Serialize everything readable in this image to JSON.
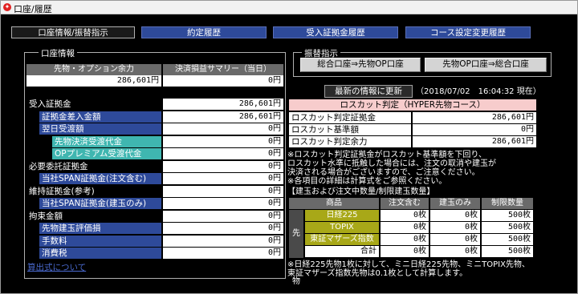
{
  "window": {
    "title": "口座/履歴",
    "app_icon": "app-logo-icon"
  },
  "tabs": [
    {
      "label": "口座情報/振替指示",
      "active": true
    },
    {
      "label": "約定履歴",
      "active": false
    },
    {
      "label": "受入証拠金履歴",
      "active": false
    },
    {
      "label": "コース設定変更履歴",
      "active": false
    }
  ],
  "account": {
    "group_title": "口座情報",
    "futures_balance_label": "先物・オプション余力",
    "futures_balance_value": "286,601円",
    "settlement_summary_label": "決済損益サマリー（当日）",
    "settlement_summary_value": "0円",
    "rows": [
      {
        "label": "受入証拠金",
        "value": "286,601円",
        "style": "dark",
        "indent": 0
      },
      {
        "label": "証拠金差入金額",
        "value": "286,601円",
        "style": "blue",
        "indent": 1
      },
      {
        "label": "翌日受渡額",
        "value": "0円",
        "style": "blue",
        "indent": 1
      },
      {
        "label": "先物決済受渡代金",
        "value": "0円",
        "style": "teal",
        "indent": 2
      },
      {
        "label": "OPプレミアム受渡代金",
        "value": "0円",
        "style": "teal",
        "indent": 2
      },
      {
        "label": "必要委託証拠金",
        "value": "0円",
        "style": "dark",
        "indent": 0
      },
      {
        "label": "当社SPAN証拠金(注文含む)",
        "value": "0円",
        "style": "blue",
        "indent": 1
      },
      {
        "label": "維持証拠金(参考)",
        "value": "0円",
        "style": "dark",
        "indent": 0
      },
      {
        "label": "当社SPAN証拠金(建玉のみ)",
        "value": "0円",
        "style": "blue",
        "indent": 1
      },
      {
        "label": "拘束金額",
        "value": "0円",
        "style": "dark",
        "indent": 0
      },
      {
        "label": "先物建玉評価損",
        "value": "0円",
        "style": "blue",
        "indent": 1
      },
      {
        "label": "手数料",
        "value": "0円",
        "style": "blue",
        "indent": 1
      },
      {
        "label": "消費税",
        "value": "0円",
        "style": "blue",
        "indent": 1
      }
    ],
    "calc_link": "算出式について"
  },
  "transfer": {
    "group_title": "振替指示",
    "btn_to_futures": "総合口座⇒先物OP口座",
    "btn_to_general": "先物OP口座⇒総合口座"
  },
  "update": {
    "button_label": "最新の情報に更新",
    "timestamp": "（2018/07/02　16:04:32 現在）"
  },
  "losscut": {
    "title": "ロスカット判定（HYPER先物コース）",
    "rows": [
      {
        "label": "ロスカット判定証拠金",
        "value": "286,601円"
      },
      {
        "label": "ロスカット基準額",
        "value": "0円"
      },
      {
        "label": "ロスカット判定余力",
        "value": "286,601円"
      }
    ],
    "notes": [
      "※ロスカット判定証拠金がロスカット基準額を下回り、",
      "ロスカット水準に抵触した場合には、注文の取消や建玉が",
      "決済される場合がございますので、ご注意ください。",
      "※各項目の詳細は計算式をご参照ください。"
    ]
  },
  "positions": {
    "section_title": "【建玉および注文中数量/制限建玉数量】",
    "headers": [
      "商品",
      "注文含む",
      "建玉のみ",
      "制限数量"
    ],
    "side_label": "先物",
    "rows": [
      {
        "name": "日経225",
        "order": "0枚",
        "held": "0枚",
        "limit": "500枚"
      },
      {
        "name": "TOPIX",
        "order": "0枚",
        "held": "0枚",
        "limit": "500枚"
      },
      {
        "name": "東証マザーズ指数",
        "order": "0枚",
        "held": "0枚",
        "limit": "500枚"
      }
    ],
    "total": {
      "name": "合計",
      "order": "0枚",
      "held": "0枚",
      "limit": "500枚"
    },
    "footnotes": [
      "※日経225先物1枚に対して、ミニ日経225先物、ミニTOPIX先物、",
      "東証マザーズ指数先物は0.1枚として計算します。"
    ]
  }
}
